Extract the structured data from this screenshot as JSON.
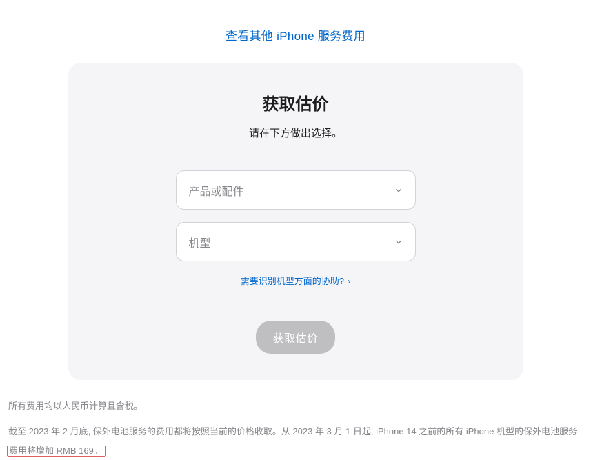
{
  "top_link": "查看其他 iPhone 服务费用",
  "card": {
    "title": "获取估价",
    "subtitle": "请在下方做出选择。",
    "select1_placeholder": "产品或配件",
    "select2_placeholder": "机型",
    "help_link": "需要识别机型方面的协助?",
    "submit_label": "获取估价"
  },
  "footer": {
    "line1": "所有费用均以人民币计算且含税。",
    "line2_part1": "截至 2023 年 2 月底, 保外电池服务的费用都将按照当前的价格收取。从 2023 年 3 月 1 日起, iPhone 14 之前的所有 iPhone 机型的保外电池服务",
    "line2_part2": "费用将增加 RMB 169。"
  }
}
